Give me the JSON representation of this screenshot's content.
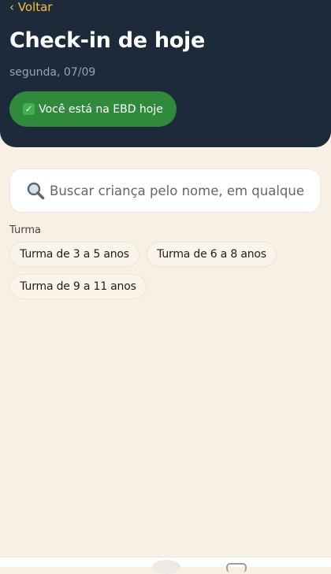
{
  "header": {
    "back_label": "‹ Voltar",
    "title": "Check-in de hoje",
    "date": "segunda, 07/09",
    "status": {
      "icon": "check-mark-icon",
      "icon_glyph": "✓",
      "label": "Você está na EBD hoje"
    }
  },
  "search": {
    "icon": "magnifier-icon",
    "placeholder": "Buscar criança pelo nome, em qualquer turma",
    "value": ""
  },
  "filters": {
    "label": "Turma",
    "options": [
      "Turma de 3 a 5 anos",
      "Turma de 6 a 8 anos",
      "Turma de 9 a 11 anos"
    ]
  },
  "colors": {
    "header_bg": "#1d2a39",
    "page_bg": "#f8f0e5",
    "accent_yellow": "#f3c238",
    "status_green": "#2f8a3b"
  }
}
